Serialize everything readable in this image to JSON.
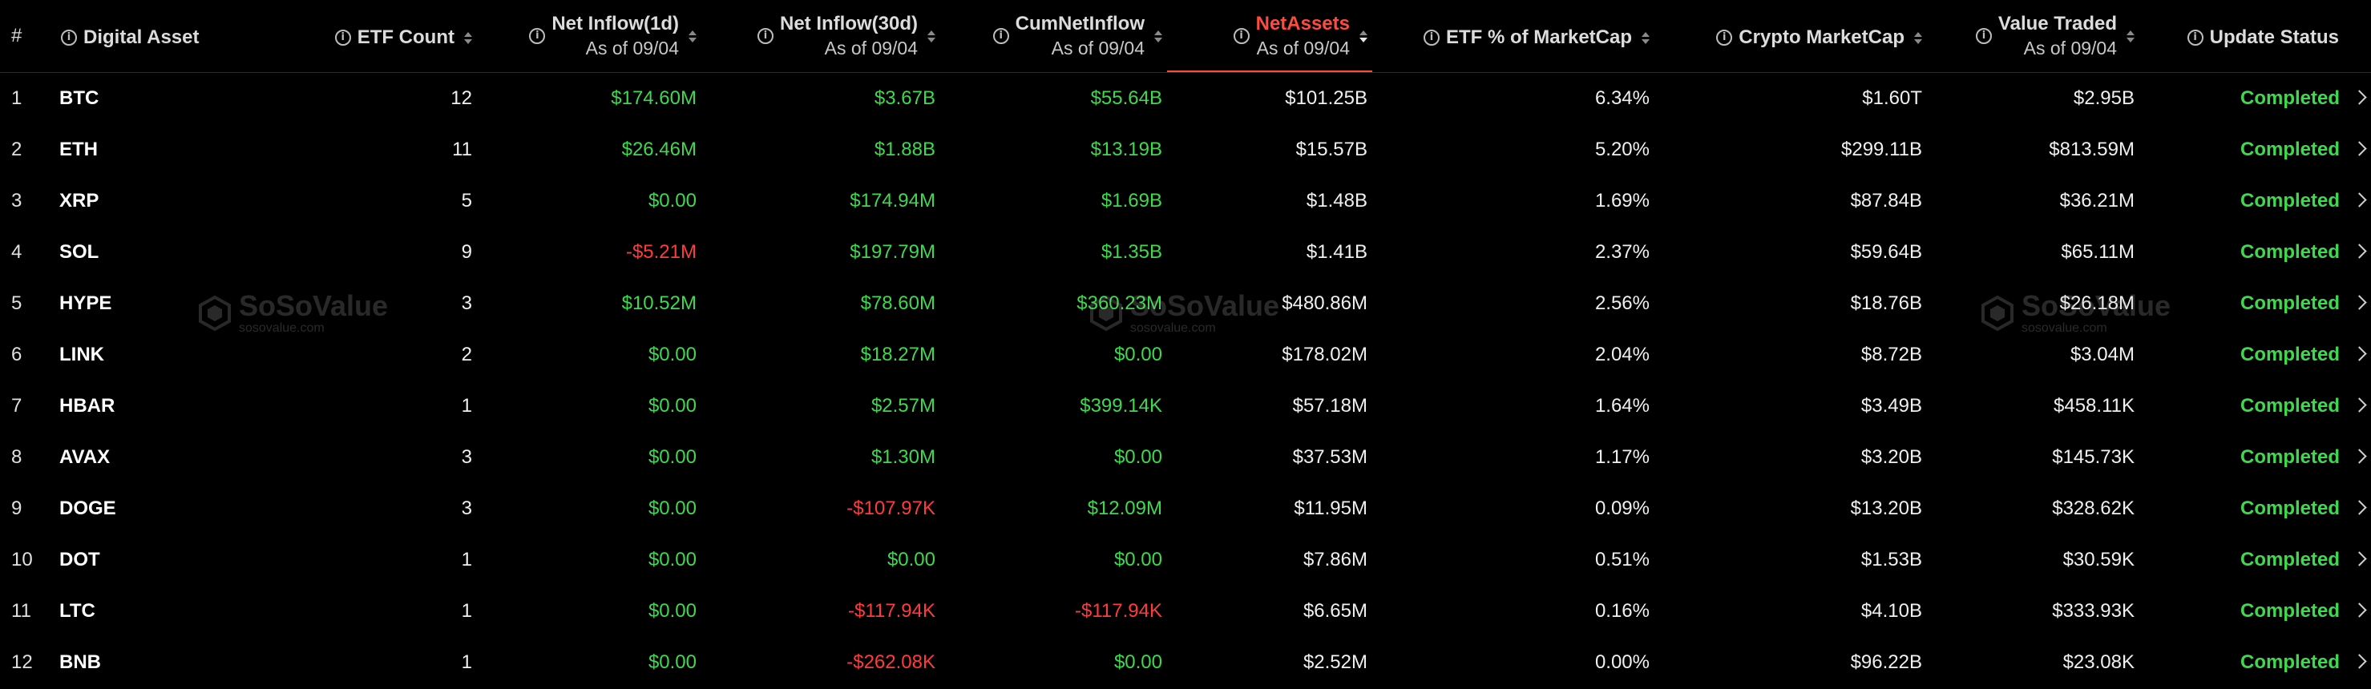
{
  "header": {
    "index": "#",
    "asset": "Digital Asset",
    "etf_count": "ETF Count",
    "net_inflow_1d": "Net Inflow(1d)",
    "net_inflow_1d_sub": "As of 09/04",
    "net_inflow_30d": "Net Inflow(30d)",
    "net_inflow_30d_sub": "As of 09/04",
    "cum_net_inflow": "CumNetInflow",
    "cum_net_inflow_sub": "As of 09/04",
    "net_assets": "NetAssets",
    "net_assets_sub": "As of 09/04",
    "etf_pct": "ETF % of MarketCap",
    "crypto_mcap": "Crypto MarketCap",
    "value_traded": "Value Traded",
    "value_traded_sub": "As of 09/04",
    "update_status": "Update Status"
  },
  "rows": [
    {
      "idx": "1",
      "asset": "BTC",
      "etf_count": "12",
      "inflow_1d": "$174.60M",
      "inflow_1d_sign": "pos",
      "inflow_30d": "$3.67B",
      "inflow_30d_sign": "pos",
      "cum": "$55.64B",
      "cum_sign": "pos",
      "net_assets": "$101.25B",
      "etf_pct": "6.34%",
      "mcap": "$1.60T",
      "traded": "$2.95B",
      "status": "Completed"
    },
    {
      "idx": "2",
      "asset": "ETH",
      "etf_count": "11",
      "inflow_1d": "$26.46M",
      "inflow_1d_sign": "pos",
      "inflow_30d": "$1.88B",
      "inflow_30d_sign": "pos",
      "cum": "$13.19B",
      "cum_sign": "pos",
      "net_assets": "$15.57B",
      "etf_pct": "5.20%",
      "mcap": "$299.11B",
      "traded": "$813.59M",
      "status": "Completed"
    },
    {
      "idx": "3",
      "asset": "XRP",
      "etf_count": "5",
      "inflow_1d": "$0.00",
      "inflow_1d_sign": "pos",
      "inflow_30d": "$174.94M",
      "inflow_30d_sign": "pos",
      "cum": "$1.69B",
      "cum_sign": "pos",
      "net_assets": "$1.48B",
      "etf_pct": "1.69%",
      "mcap": "$87.84B",
      "traded": "$36.21M",
      "status": "Completed"
    },
    {
      "idx": "4",
      "asset": "SOL",
      "etf_count": "9",
      "inflow_1d": "-$5.21M",
      "inflow_1d_sign": "neg",
      "inflow_30d": "$197.79M",
      "inflow_30d_sign": "pos",
      "cum": "$1.35B",
      "cum_sign": "pos",
      "net_assets": "$1.41B",
      "etf_pct": "2.37%",
      "mcap": "$59.64B",
      "traded": "$65.11M",
      "status": "Completed"
    },
    {
      "idx": "5",
      "asset": "HYPE",
      "etf_count": "3",
      "inflow_1d": "$10.52M",
      "inflow_1d_sign": "pos",
      "inflow_30d": "$78.60M",
      "inflow_30d_sign": "pos",
      "cum": "$360.23M",
      "cum_sign": "pos",
      "net_assets": "$480.86M",
      "etf_pct": "2.56%",
      "mcap": "$18.76B",
      "traded": "$26.18M",
      "status": "Completed"
    },
    {
      "idx": "6",
      "asset": "LINK",
      "etf_count": "2",
      "inflow_1d": "$0.00",
      "inflow_1d_sign": "pos",
      "inflow_30d": "$18.27M",
      "inflow_30d_sign": "pos",
      "cum": "$0.00",
      "cum_sign": "pos",
      "net_assets": "$178.02M",
      "etf_pct": "2.04%",
      "mcap": "$8.72B",
      "traded": "$3.04M",
      "status": "Completed"
    },
    {
      "idx": "7",
      "asset": "HBAR",
      "etf_count": "1",
      "inflow_1d": "$0.00",
      "inflow_1d_sign": "pos",
      "inflow_30d": "$2.57M",
      "inflow_30d_sign": "pos",
      "cum": "$399.14K",
      "cum_sign": "pos",
      "net_assets": "$57.18M",
      "etf_pct": "1.64%",
      "mcap": "$3.49B",
      "traded": "$458.11K",
      "status": "Completed"
    },
    {
      "idx": "8",
      "asset": "AVAX",
      "etf_count": "3",
      "inflow_1d": "$0.00",
      "inflow_1d_sign": "pos",
      "inflow_30d": "$1.30M",
      "inflow_30d_sign": "pos",
      "cum": "$0.00",
      "cum_sign": "pos",
      "net_assets": "$37.53M",
      "etf_pct": "1.17%",
      "mcap": "$3.20B",
      "traded": "$145.73K",
      "status": "Completed"
    },
    {
      "idx": "9",
      "asset": "DOGE",
      "etf_count": "3",
      "inflow_1d": "$0.00",
      "inflow_1d_sign": "pos",
      "inflow_30d": "-$107.97K",
      "inflow_30d_sign": "neg",
      "cum": "$12.09M",
      "cum_sign": "pos",
      "net_assets": "$11.95M",
      "etf_pct": "0.09%",
      "mcap": "$13.20B",
      "traded": "$328.62K",
      "status": "Completed"
    },
    {
      "idx": "10",
      "asset": "DOT",
      "etf_count": "1",
      "inflow_1d": "$0.00",
      "inflow_1d_sign": "pos",
      "inflow_30d": "$0.00",
      "inflow_30d_sign": "pos",
      "cum": "$0.00",
      "cum_sign": "pos",
      "net_assets": "$7.86M",
      "etf_pct": "0.51%",
      "mcap": "$1.53B",
      "traded": "$30.59K",
      "status": "Completed"
    },
    {
      "idx": "11",
      "asset": "LTC",
      "etf_count": "1",
      "inflow_1d": "$0.00",
      "inflow_1d_sign": "pos",
      "inflow_30d": "-$117.94K",
      "inflow_30d_sign": "neg",
      "cum": "-$117.94K",
      "cum_sign": "neg",
      "net_assets": "$6.65M",
      "etf_pct": "0.16%",
      "mcap": "$4.10B",
      "traded": "$333.93K",
      "status": "Completed"
    },
    {
      "idx": "12",
      "asset": "BNB",
      "etf_count": "1",
      "inflow_1d": "$0.00",
      "inflow_1d_sign": "pos",
      "inflow_30d": "-$262.08K",
      "inflow_30d_sign": "neg",
      "cum": "$0.00",
      "cum_sign": "pos",
      "net_assets": "$2.52M",
      "etf_pct": "0.00%",
      "mcap": "$96.22B",
      "traded": "$23.08K",
      "status": "Completed"
    }
  ],
  "watermark": {
    "brand": "SoSoValue",
    "site": "sosovalue.com"
  },
  "colors": {
    "positive": "#3fd84f",
    "negative": "#ff3b3b",
    "active_sort": "#ff4b3e",
    "background": "#000000"
  }
}
